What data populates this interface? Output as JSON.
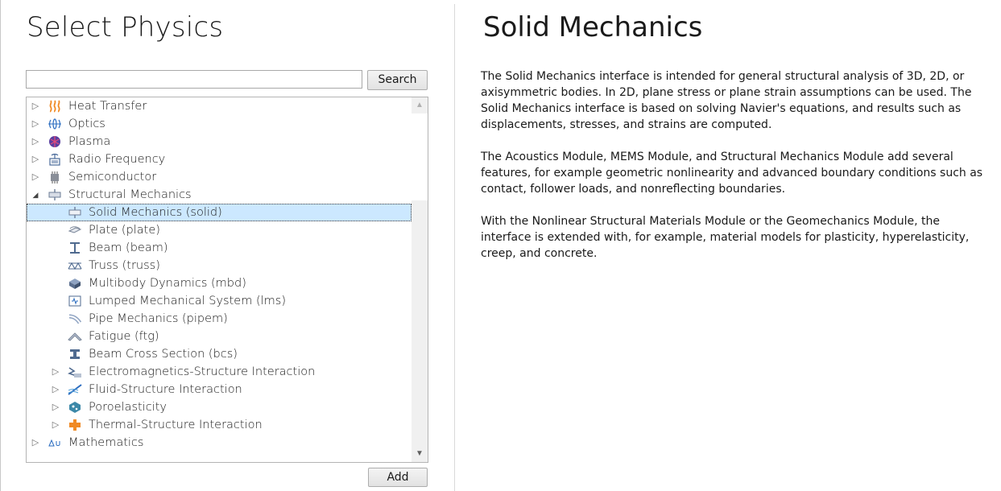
{
  "left": {
    "title": "Select Physics",
    "search": {
      "value": "",
      "placeholder": "",
      "button": "Search"
    },
    "add_button": "Add"
  },
  "tree": [
    {
      "label": "Heat Transfer",
      "icon": "heat-transfer-icon",
      "level": 0,
      "expander": "collapsed"
    },
    {
      "label": "Optics",
      "icon": "optics-icon",
      "level": 0,
      "expander": "collapsed"
    },
    {
      "label": "Plasma",
      "icon": "plasma-icon",
      "level": 0,
      "expander": "collapsed"
    },
    {
      "label": "Radio Frequency",
      "icon": "radio-frequency-icon",
      "level": 0,
      "expander": "collapsed"
    },
    {
      "label": "Semiconductor",
      "icon": "semiconductor-icon",
      "level": 0,
      "expander": "collapsed"
    },
    {
      "label": "Structural Mechanics",
      "icon": "structural-mechanics-icon",
      "level": 0,
      "expander": "expanded"
    },
    {
      "label": "Solid Mechanics (solid)",
      "icon": "solid-mechanics-icon",
      "level": 1,
      "expander": "none",
      "selected": true
    },
    {
      "label": "Plate (plate)",
      "icon": "plate-icon",
      "level": 1,
      "expander": "none"
    },
    {
      "label": "Beam (beam)",
      "icon": "beam-icon",
      "level": 1,
      "expander": "none"
    },
    {
      "label": "Truss (truss)",
      "icon": "truss-icon",
      "level": 1,
      "expander": "none"
    },
    {
      "label": "Multibody Dynamics (mbd)",
      "icon": "multibody-dynamics-icon",
      "level": 1,
      "expander": "none"
    },
    {
      "label": "Lumped Mechanical System (lms)",
      "icon": "lumped-mechanical-system-icon",
      "level": 1,
      "expander": "none"
    },
    {
      "label": "Pipe Mechanics (pipem)",
      "icon": "pipe-mechanics-icon",
      "level": 1,
      "expander": "none"
    },
    {
      "label": "Fatigue (ftg)",
      "icon": "fatigue-icon",
      "level": 1,
      "expander": "none"
    },
    {
      "label": "Beam Cross Section (bcs)",
      "icon": "beam-cross-section-icon",
      "level": 1,
      "expander": "none"
    },
    {
      "label": "Electromagnetics-Structure Interaction",
      "icon": "electromagnetics-structure-icon",
      "level": 1,
      "expander": "collapsed"
    },
    {
      "label": "Fluid-Structure Interaction",
      "icon": "fluid-structure-icon",
      "level": 1,
      "expander": "collapsed"
    },
    {
      "label": "Poroelasticity",
      "icon": "poroelasticity-icon",
      "level": 1,
      "expander": "collapsed"
    },
    {
      "label": "Thermal-Structure Interaction",
      "icon": "thermal-structure-icon",
      "level": 1,
      "expander": "collapsed"
    },
    {
      "label": "Mathematics",
      "icon": "mathematics-icon",
      "level": 0,
      "expander": "collapsed"
    }
  ],
  "right": {
    "title": "Solid Mechanics",
    "paragraphs": [
      "The Solid Mechanics interface is intended for general structural analysis of 3D, 2D, or axisymmetric bodies. In 2D, plane stress or plane strain assumptions can be used. The Solid Mechanics interface is based on solving Navier's equations, and results such as displacements, stresses, and strains are computed.",
      "The Acoustics Module, MEMS Module, and Structural Mechanics Module add several features, for example geometric nonlinearity and advanced boundary conditions such as contact, follower loads, and nonreflecting boundaries.",
      "With the Nonlinear Structural Materials Module or the Geomechanics Module, the interface is extended with, for example, material models for plasticity, hyperelasticity, creep, and concrete."
    ]
  },
  "colors": {
    "selection": "#cce8ff",
    "heat": "#f08a24",
    "accent": "#2a6cc0"
  }
}
